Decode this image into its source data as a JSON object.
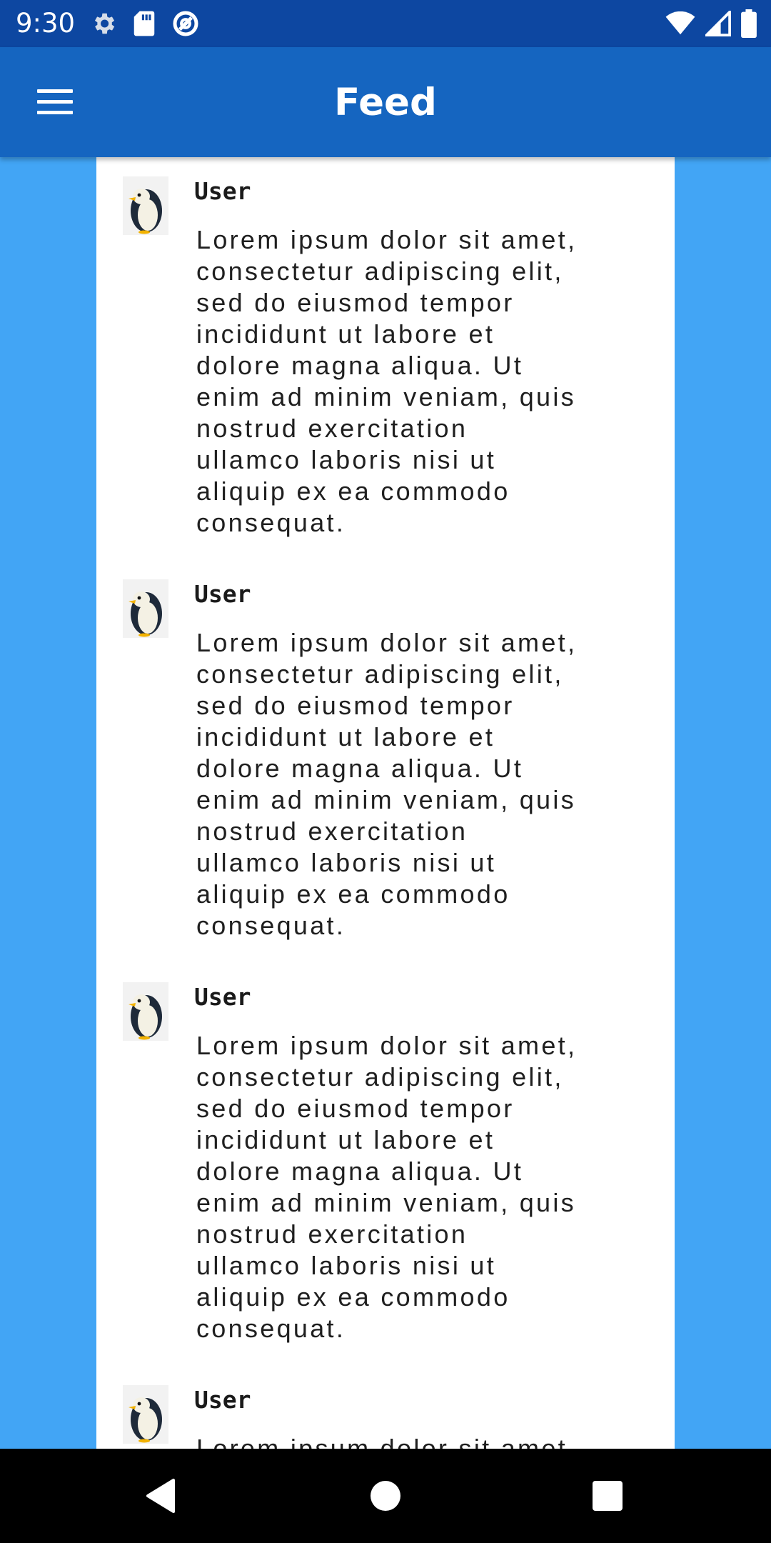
{
  "status_bar": {
    "time": "9:30",
    "left_icons": [
      "settings-icon",
      "sd-card-icon",
      "data-saver-icon"
    ],
    "right_icons": [
      "wifi-icon",
      "cell-signal-icon",
      "battery-icon"
    ]
  },
  "app_bar": {
    "title": "Feed",
    "menu_icon": "menu-icon"
  },
  "colors": {
    "status_bar": "#0d47a1",
    "app_bar": "#1565c0",
    "background": "#42a5f5",
    "card": "#ffffff",
    "nav_bar": "#000000"
  },
  "feed": {
    "posts": [
      {
        "username": "User",
        "avatar": "penguin-avatar",
        "body": "Lorem ipsum dolor sit amet,\nconsectetur adipiscing elit,\nsed do eiusmod tempor\nincididunt ut labore et\ndolore magna aliqua. Ut\nenim ad minim veniam, quis\nnostrud exercitation\nullamco laboris nisi ut\naliquip ex ea commodo\nconsequat."
      },
      {
        "username": "User",
        "avatar": "penguin-avatar",
        "body": "Lorem ipsum dolor sit amet,\nconsectetur adipiscing elit,\nsed do eiusmod tempor\nincididunt ut labore et\ndolore magna aliqua. Ut\nenim ad minim veniam, quis\nnostrud exercitation\nullamco laboris nisi ut\naliquip ex ea commodo\nconsequat."
      },
      {
        "username": "User",
        "avatar": "penguin-avatar",
        "body": "Lorem ipsum dolor sit amet,\nconsectetur adipiscing elit,\nsed do eiusmod tempor\nincididunt ut labore et\ndolore magna aliqua. Ut\nenim ad minim veniam, quis\nnostrud exercitation\nullamco laboris nisi ut\naliquip ex ea commodo\nconsequat."
      },
      {
        "username": "User",
        "avatar": "penguin-avatar",
        "body": "Lorem ipsum dolor sit amet,"
      }
    ]
  },
  "nav_bar": {
    "buttons": [
      "back-icon",
      "home-icon",
      "recents-icon"
    ]
  }
}
